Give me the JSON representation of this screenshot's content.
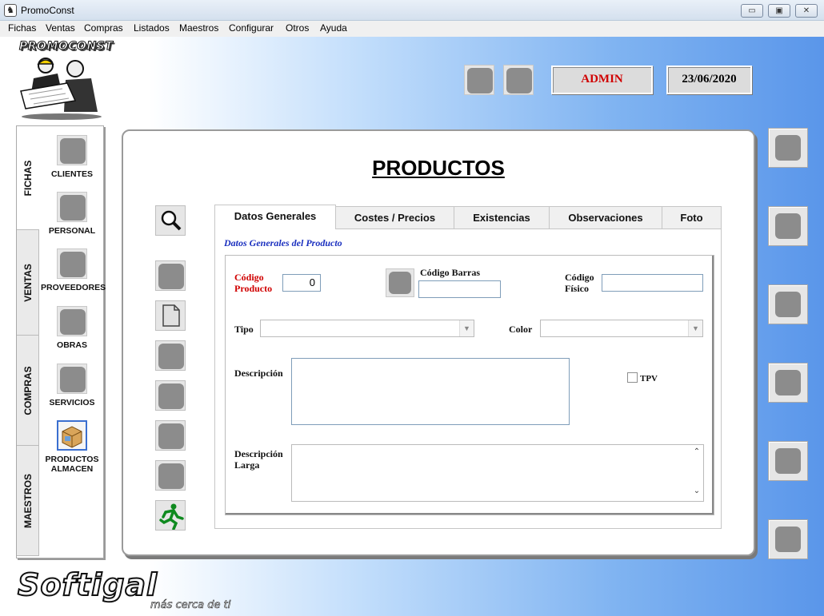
{
  "window": {
    "title": "PromoConst",
    "controls": {
      "minimize": "▭",
      "maximize": "▣",
      "close": "✕"
    }
  },
  "menu": [
    "Fichas",
    "Ventas",
    "Compras",
    "Listados",
    "Maestros",
    "Configurar",
    "Otros",
    "Ayuda"
  ],
  "header": {
    "brand": "PROMOCONST",
    "user": "ADMIN",
    "date": "23/06/2020",
    "user_color": "#d00000"
  },
  "sidebar": {
    "tabs": [
      "FICHAS",
      "VENTAS",
      "COMPRAS",
      "MAESTROS"
    ],
    "active_tab": "FICHAS",
    "items": [
      {
        "label": "CLIENTES",
        "icon": "clients-icon"
      },
      {
        "label": "PERSONAL",
        "icon": "staff-icon"
      },
      {
        "label": "PROVEEDORES",
        "icon": "suppliers-icon"
      },
      {
        "label": "OBRAS",
        "icon": "works-icon"
      },
      {
        "label": "SERVICIOS",
        "icon": "services-icon"
      },
      {
        "label": "PRODUCTOS ALMACEN",
        "icon": "products-warehouse-icon",
        "active": true
      }
    ]
  },
  "main": {
    "title": "PRODUCTOS",
    "tabs": [
      "Datos Generales",
      "Costes / Precios",
      "Existencias",
      "Observaciones",
      "Foto"
    ],
    "active_tab": "Datos Generales",
    "section_title": "Datos Generales del Producto",
    "fields": {
      "codigo_producto_label": "Código Producto",
      "codigo_producto_value": "0",
      "codigo_barras_label": "Código Barras",
      "codigo_barras_value": "",
      "codigo_fisico_label": "Código Físico",
      "codigo_fisico_value": "",
      "tipo_label": "Tipo",
      "tipo_value": "",
      "color_label": "Color",
      "color_value": "",
      "descripcion_label": "Descripción",
      "descripcion_value": "",
      "tpv_label": "TPV",
      "tpv_checked": false,
      "descripcion_larga_label": "Descripción Larga",
      "descripcion_larga_value": ""
    }
  },
  "footer": {
    "logo": "Softigal",
    "slogan": "más cerca de ti"
  },
  "colors": {
    "accent_blue": "#3b6fd0",
    "section_title": "#1a2fbf",
    "required_label": "#d00000"
  }
}
